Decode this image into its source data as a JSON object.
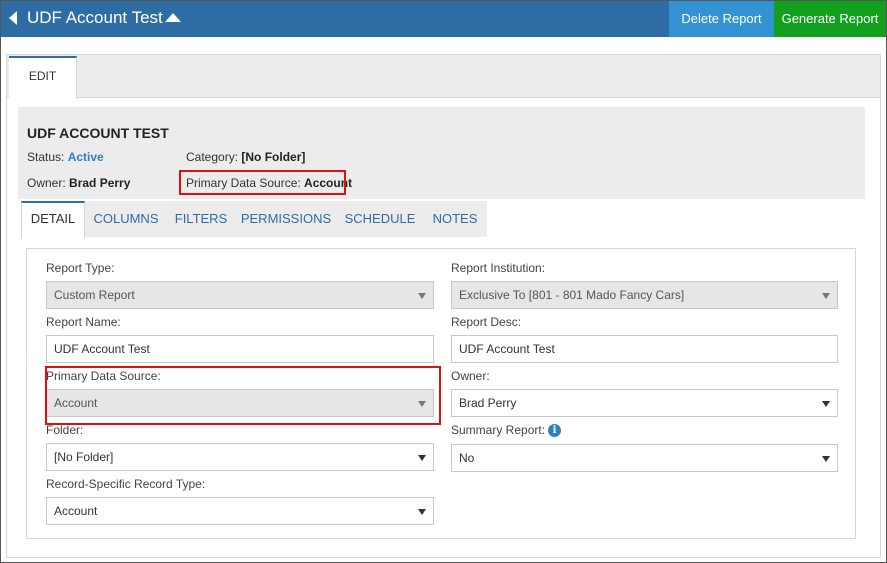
{
  "topbar": {
    "title": "UDF Account Test",
    "delete_label": "Delete Report",
    "generate_label": "Generate Report"
  },
  "outer_tabs": {
    "edit": "EDIT"
  },
  "header": {
    "name": "UDF ACCOUNT TEST",
    "status_label": "Status:",
    "status_value": "Active",
    "category_label": "Category:",
    "category_value": "[No Folder]",
    "owner_label": "Owner:",
    "owner_value": "Brad Perry",
    "pds_label": "Primary Data Source:",
    "pds_value": "Account"
  },
  "tabs": [
    "DETAIL",
    "COLUMNS",
    "FILTERS",
    "PERMISSIONS",
    "SCHEDULE",
    "NOTES"
  ],
  "form": {
    "report_type": {
      "label": "Report Type:",
      "value": "Custom Report"
    },
    "report_institution": {
      "label": "Report Institution:",
      "value": "Exclusive To [801 - 801 Mado Fancy Cars]"
    },
    "report_name": {
      "label": "Report Name:",
      "value": "UDF Account Test"
    },
    "report_desc": {
      "label": "Report Desc:",
      "value": "UDF Account Test"
    },
    "primary_data_source": {
      "label": "Primary Data Source:",
      "value": "Account"
    },
    "owner": {
      "label": "Owner:",
      "value": "Brad Perry"
    },
    "folder": {
      "label": "Folder:",
      "value": "[No Folder]"
    },
    "summary_report": {
      "label": "Summary Report:",
      "value": "No"
    },
    "record_type": {
      "label": "Record-Specific Record Type:",
      "value": "Account"
    }
  },
  "colors": {
    "topbar": "#2e6da4",
    "delete": "#3292d2",
    "generate": "#14a01f",
    "highlight": "#dd1111"
  }
}
